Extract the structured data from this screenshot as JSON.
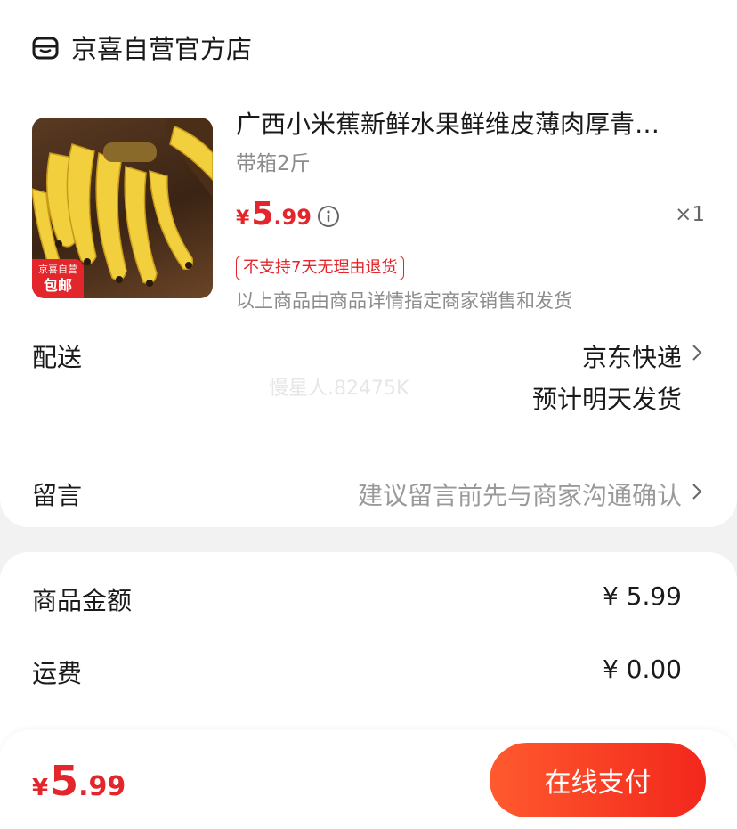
{
  "shop": {
    "name": "京喜自营官方店",
    "icon": "store-icon"
  },
  "product": {
    "title": "广西小米蕉新鲜水果鲜维皮薄肉厚青…",
    "spec": "带箱2斤",
    "price": {
      "currency": "¥",
      "integer": "5",
      "decimal": ".99"
    },
    "quantity": "×1",
    "image_badge": {
      "line1": "京喜自营",
      "line2": "包邮"
    },
    "no_return_tag": "不支持7天无理由退货",
    "seller_note": "以上商品由商品详情指定商家销售和发货"
  },
  "delivery": {
    "label": "配送",
    "method": "京东快递",
    "estimate": "预计明天发货"
  },
  "watermark": "慢星人.82475K",
  "message": {
    "label": "留言",
    "hint": "建议留言前先与商家沟通确认"
  },
  "summary": {
    "goods_label": "商品金额",
    "goods_value": "¥ 5.99",
    "shipping_label": "运费",
    "shipping_value": "¥ 0.00"
  },
  "footer": {
    "total": {
      "currency": "¥",
      "integer": "5",
      "decimal": ".99"
    },
    "pay_button": "在线支付"
  },
  "colors": {
    "accent": "#e3262b",
    "button_gradient_start": "#ff5a2e",
    "button_gradient_end": "#f2271c"
  }
}
